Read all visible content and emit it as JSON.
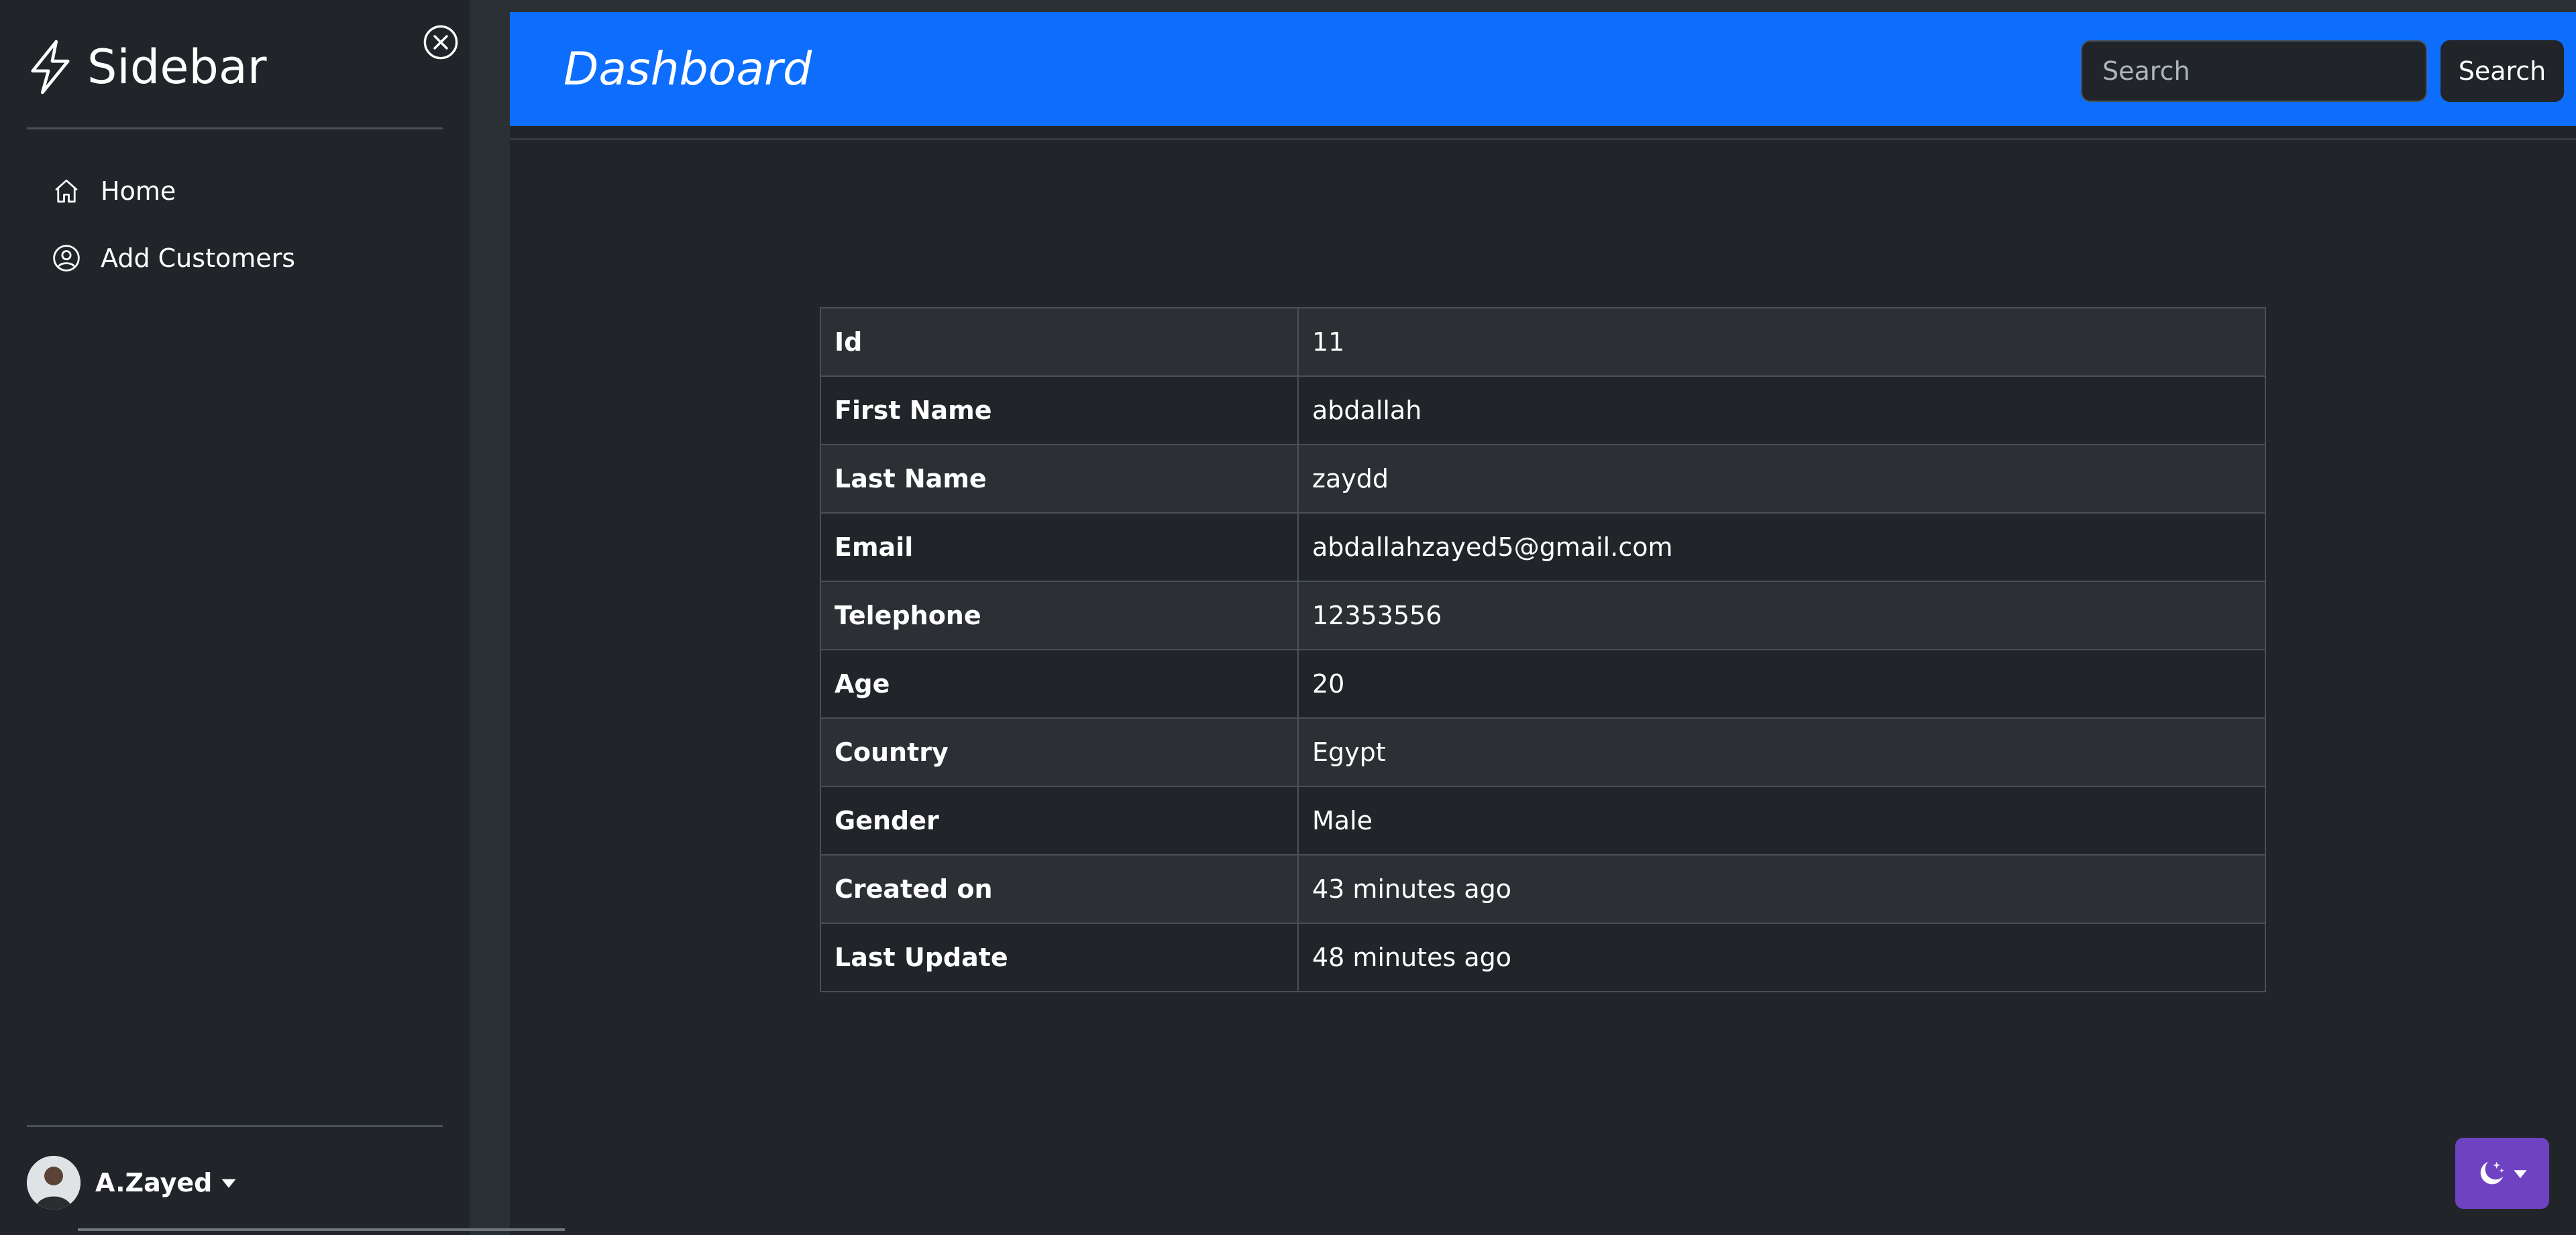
{
  "sidebar": {
    "brand": "Sidebar",
    "brand_icon": "lightning-icon",
    "close_icon": "close-circle-icon",
    "items": [
      {
        "label": "Home",
        "icon": "house-icon"
      },
      {
        "label": "Add Customers",
        "icon": "person-circle-icon"
      }
    ],
    "user": {
      "name": "A.Zayed",
      "icon": "caret-down-icon"
    }
  },
  "header": {
    "title": "Dashboard",
    "search_placeholder": "Search",
    "search_button": "Search"
  },
  "customer": {
    "rows": [
      {
        "label": "Id",
        "value": "11"
      },
      {
        "label": "First Name",
        "value": "abdallah"
      },
      {
        "label": "Last Name",
        "value": "zaydd"
      },
      {
        "label": "Email",
        "value": "abdallahzayed5@gmail.com"
      },
      {
        "label": "Telephone",
        "value": "12353556"
      },
      {
        "label": "Age",
        "value": "20"
      },
      {
        "label": "Country",
        "value": "Egypt"
      },
      {
        "label": "Gender",
        "value": "Male"
      },
      {
        "label": "Created on",
        "value": "43 minutes ago"
      },
      {
        "label": "Last Update",
        "value": "48 minutes ago"
      }
    ]
  },
  "theme_toggle": {
    "icon": "moon-stars-icon"
  },
  "colors": {
    "accent": "#0d6efd",
    "theme_toggle": "#6f42c1",
    "background": "#212529"
  }
}
